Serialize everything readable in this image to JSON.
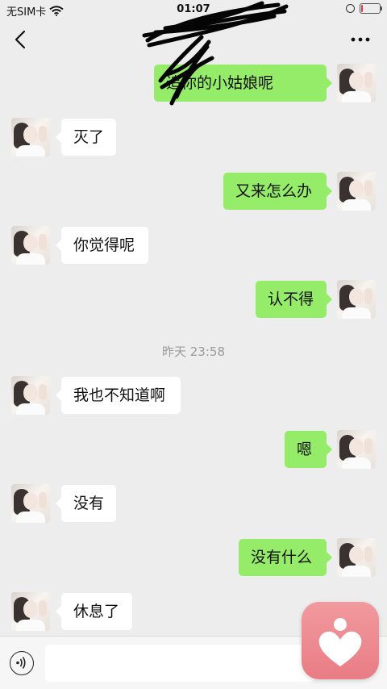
{
  "status": {
    "carrier": "无SIM卡",
    "time": "01:07",
    "battery_level": 0.1,
    "battery_color": "#e0393e"
  },
  "navbar": {
    "back_icon": "chevron-left-icon",
    "more_icon": "more-dots-icon"
  },
  "messages": [
    {
      "side": "right",
      "text": "追你的小姑娘呢"
    },
    {
      "side": "left",
      "text": "灭了"
    },
    {
      "side": "right",
      "text": "又来怎么办"
    },
    {
      "side": "left",
      "text": "你觉得呢"
    },
    {
      "side": "right",
      "text": "认不得"
    },
    {
      "side": "left",
      "text": "我也不知道啊"
    },
    {
      "side": "right",
      "text": "嗯"
    },
    {
      "side": "left",
      "text": "没有"
    },
    {
      "side": "right",
      "text": "没有什么"
    },
    {
      "side": "left",
      "text": "休息了"
    }
  ],
  "timestamp": "昨天 23:58",
  "input": {
    "value": "",
    "voice_icon": "voice-icon"
  },
  "floating_app": {
    "icon": "heart-person-icon",
    "color": "#ea7f87"
  },
  "colors": {
    "background": "#ededed",
    "outgoing_bubble": "#95ec69",
    "incoming_bubble": "#ffffff"
  }
}
